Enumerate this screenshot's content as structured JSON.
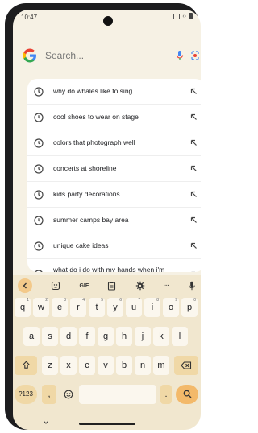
{
  "status_bar": {
    "time": "10:47"
  },
  "search": {
    "placeholder": "Search..."
  },
  "suggestions": [
    {
      "text": "why do whales like to sing"
    },
    {
      "text": "cool shoes to wear on stage"
    },
    {
      "text": "colors that photograph well"
    },
    {
      "text": "concerts at shoreline"
    },
    {
      "text": "kids party decorations"
    },
    {
      "text": "summer camps bay area"
    },
    {
      "text": "unique cake ideas"
    },
    {
      "text": "what do i do with my hands when i'm presenting"
    }
  ],
  "keyboard": {
    "toolbar": {
      "gif_label": "GIF",
      "more_label": "···"
    },
    "row1": [
      {
        "key": "q",
        "num": "1"
      },
      {
        "key": "w",
        "num": "2"
      },
      {
        "key": "e",
        "num": "3"
      },
      {
        "key": "r",
        "num": "4"
      },
      {
        "key": "t",
        "num": "5"
      },
      {
        "key": "y",
        "num": "6"
      },
      {
        "key": "u",
        "num": "7"
      },
      {
        "key": "i",
        "num": "8"
      },
      {
        "key": "o",
        "num": "9"
      },
      {
        "key": "p",
        "num": "0"
      }
    ],
    "row2": [
      "a",
      "s",
      "d",
      "f",
      "g",
      "h",
      "j",
      "k",
      "l"
    ],
    "row3": [
      "z",
      "x",
      "c",
      "v",
      "b",
      "n",
      "m"
    ],
    "row4": {
      "symbols_label": "?123",
      "comma_label": ",",
      "period_label": "."
    }
  },
  "colors": {
    "screen_bg": "#f6f1e4",
    "keyboard_bg": "#f1e7cf",
    "key_bg": "#fbf7ee",
    "fn_key_bg": "#f0d8a6",
    "action_key_bg": "#f3b96a",
    "google_blue": "#4285f4"
  }
}
